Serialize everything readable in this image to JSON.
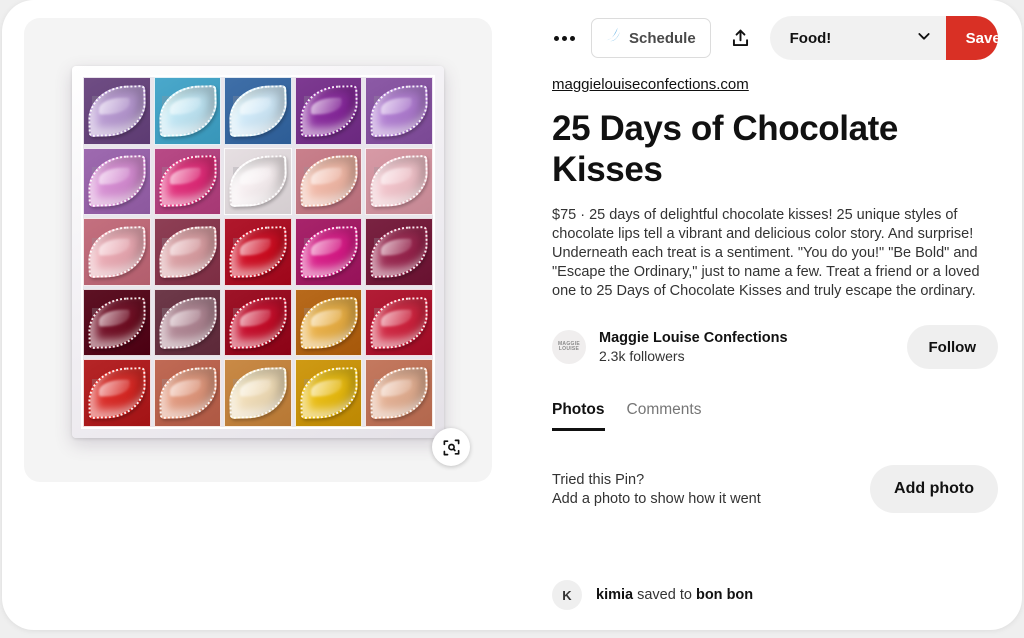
{
  "actions": {
    "more_icon": "kebab-menu-icon",
    "schedule_label": "Schedule",
    "schedule_icon": "feather-wing-icon",
    "share_icon": "share-upload-icon",
    "board_name": "Food!",
    "board_chevron_icon": "chevron-down-icon",
    "save_label": "Save",
    "save_color": "#d93025"
  },
  "pin": {
    "source_url": "maggielouiseconfections.com",
    "title": "25 Days of Chocolate Kisses",
    "description": "$75 · 25 days of delightful chocolate kisses! 25 unique styles of chocolate lips tell a vibrant and delicious color story. And surprise! Underneath each treat is a sentiment. \"You do you!\" \"Be Bold\" and \"Escape the Ordinary,\" just to name a few. Treat a friend or a loved one to 25 Days of Chocolate Kisses and truly escape the ordinary.",
    "visual_search_icon": "visual-search-icon"
  },
  "creator": {
    "avatar_line1": "MAGGIE",
    "avatar_line2": "LOUISE",
    "name": "Maggie Louise Confections",
    "followers": "2.3k followers",
    "follow_label": "Follow"
  },
  "tabs": [
    {
      "label": "Photos",
      "active": true
    },
    {
      "label": "Comments",
      "active": false
    }
  ],
  "tried": {
    "line1": "Tried this Pin?",
    "line2": "Add a photo to show how it went",
    "button_label": "Add photo"
  },
  "saved_by": {
    "avatar_initial": "K",
    "user": "kimia",
    "middle": " saved to ",
    "board": "bon bon"
  },
  "photo": {
    "alt": "Boxed grid of 25 chocolate lip confections",
    "rows": 5,
    "cols": 5,
    "cell_colors": [
      [
        "#6f4d84",
        "#4aa8cb",
        "#3f6fa8",
        "#7d3a91",
        "#8c5aa6"
      ],
      [
        "#9e6ab0",
        "#b84a86",
        "#e6dfe2",
        "#c9808c",
        "#d79aa6"
      ],
      [
        "#c4707f",
        "#8e3f55",
        "#b0182c",
        "#a8246b",
        "#7a2342"
      ],
      [
        "#5d1224",
        "#6e3a4a",
        "#9e1428",
        "#b86a1c",
        "#b21d36"
      ],
      [
        "#b52527",
        "#c06a55",
        "#c98a46",
        "#cf9a14",
        "#c4795f"
      ]
    ],
    "lip_colors": [
      [
        "#b79ad0",
        "#bfe4f2",
        "#cfe8f7",
        "#8a2f9e",
        "#b07fd0"
      ],
      [
        "#d58fd2",
        "#e0327c",
        "#f6eef0",
        "#f0b9a8",
        "#f0c3ca"
      ],
      [
        "#e8aab3",
        "#d9a0a4",
        "#cf1228",
        "#d8228a",
        "#9a2b52"
      ],
      [
        "#74142a",
        "#b08895",
        "#c61230",
        "#e8b04a",
        "#cf2a44"
      ],
      [
        "#d92f2b",
        "#e09a80",
        "#efdcb8",
        "#e8bc16",
        "#e2b094"
      ]
    ]
  }
}
